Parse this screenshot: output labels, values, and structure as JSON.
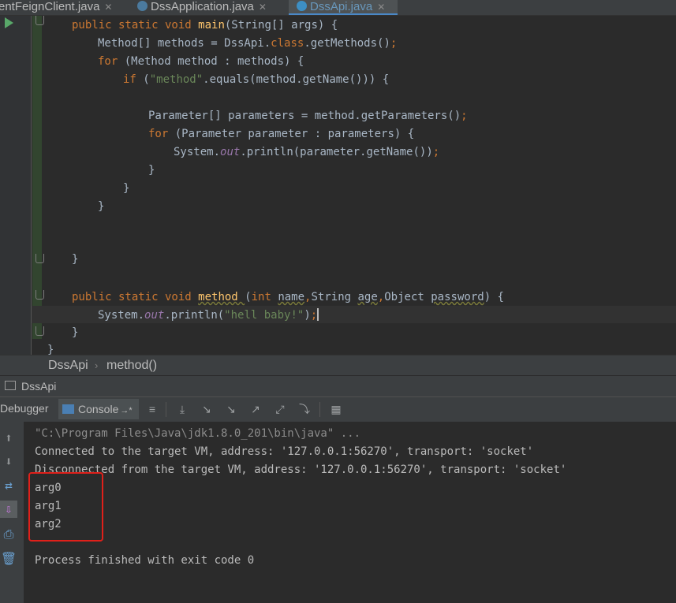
{
  "tabs": [
    {
      "label": "entFeignClient.java",
      "active": false
    },
    {
      "label": "DssApplication.java",
      "active": false
    },
    {
      "label": "DssApi.java",
      "active": true
    }
  ],
  "code": {
    "l1": {
      "a": "public static void ",
      "b": "main",
      "c": "(String[] args) {"
    },
    "l2": {
      "a": "Method[] methods = DssApi.",
      "b": "class",
      "c": ".getMethods()",
      "d": ";"
    },
    "l3": {
      "a": "for ",
      "b": "(Method method : methods) {"
    },
    "l4": {
      "a": "if ",
      "b": "(",
      "c": "\"method\"",
      "d": ".equals(method.getName())) {"
    },
    "l5": {
      "a": "Parameter[] parameters = method.getParameters()",
      "b": ";"
    },
    "l6": {
      "a": "for ",
      "b": "(Parameter parameter : parameters) {"
    },
    "l7": {
      "a": "System.",
      "b": "out",
      "c": ".println(parameter.getName())",
      "d": ";"
    },
    "brace": "}",
    "l13": {
      "a": "public static void ",
      "b": "method ",
      "c": "(",
      "d": "int ",
      "e": "name",
      "f": ",",
      "g": "String ",
      "h": "age",
      "i": ",",
      "j": "Object ",
      "k": "password",
      "l": ") {"
    },
    "l14": {
      "a": "System.",
      "b": "out",
      "c": ".println(",
      "d": "\"hell baby!\"",
      "e": ")",
      "f": ";"
    }
  },
  "breadcrumb": {
    "file": "DssApi",
    "method": "method()",
    "separator": "›"
  },
  "run_panel": {
    "title": "DssApi"
  },
  "toolbar": {
    "debugger_label": "Debugger",
    "console_label": "Console",
    "console_pin": "→*"
  },
  "console": {
    "lines": [
      "\"C:\\Program Files\\Java\\jdk1.8.0_201\\bin\\java\" ...",
      "Connected to the target VM, address: '127.0.0.1:56270', transport: 'socket'",
      "Disconnected from the target VM, address: '127.0.0.1:56270', transport: 'socket'",
      "arg0",
      "arg1",
      "arg2",
      "",
      "Process finished with exit code 0"
    ]
  },
  "colors": {
    "keyword": "#cc7832",
    "method": "#ffc66d",
    "string": "#6a8759",
    "field": "#9876aa",
    "highlight_box": "#e0201a"
  }
}
